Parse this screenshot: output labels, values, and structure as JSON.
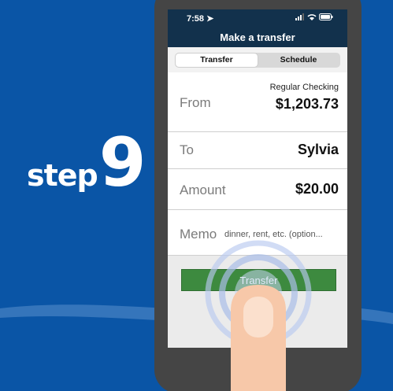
{
  "step": {
    "word": "step",
    "number": "9"
  },
  "status_bar": {
    "time": "7:58",
    "location_icon": "location-arrow-icon",
    "signal_icon": "cellular-signal-icon",
    "wifi_icon": "wifi-icon",
    "battery_icon": "battery-icon"
  },
  "nav": {
    "title": "Make a transfer"
  },
  "tabs": [
    {
      "label": "Transfer",
      "selected": true
    },
    {
      "label": "Schedule",
      "selected": false
    }
  ],
  "form": {
    "from": {
      "label": "From",
      "account_name": "Regular Checking",
      "balance": "$1,203.73"
    },
    "to": {
      "label": "To",
      "value": "Sylvia"
    },
    "amount": {
      "label": "Amount",
      "value": "$20.00"
    },
    "memo": {
      "label": "Memo",
      "placeholder": "dinner, rent, etc. (option..."
    }
  },
  "transfer_button": {
    "label": "Transfer"
  },
  "colors": {
    "background": "#0a55a6",
    "nav_bar": "#12314c",
    "button": "#3d8a3f",
    "phone_frame": "#454545"
  }
}
